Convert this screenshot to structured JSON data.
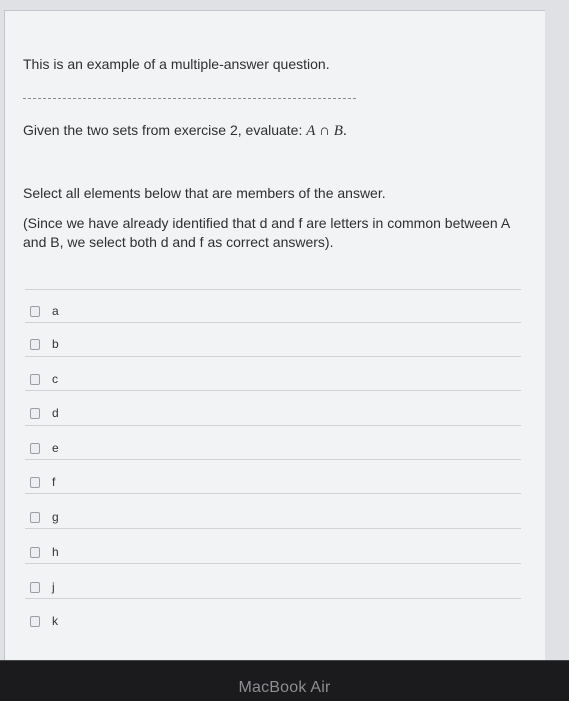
{
  "question": {
    "intro": "This is an example of a multiple-answer question.",
    "prompt": "Given the two sets from exercise 2, evaluate: ",
    "expr_a": "A",
    "expr_op": " ∩ ",
    "expr_b": "B",
    "expr_end": ".",
    "instruction": "Select all elements below that are members of the answer.",
    "explanation": "(Since we have already identified that d and f are letters in common between A and B, we select both d and f as correct answers)."
  },
  "options": [
    "a",
    "b",
    "c",
    "d",
    "e",
    "f",
    "g",
    "h",
    "j",
    "k"
  ],
  "device": {
    "brand": "MacBook Air"
  }
}
